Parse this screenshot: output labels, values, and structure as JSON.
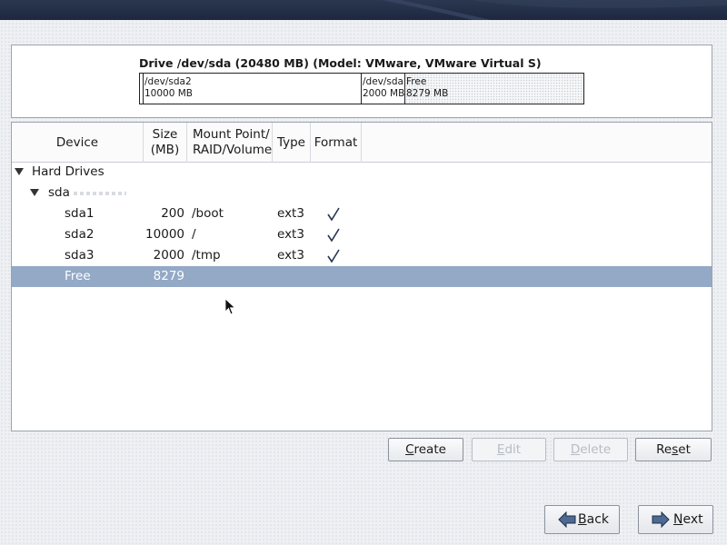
{
  "drive": {
    "title": "Drive /dev/sda (20480 MB) (Model: VMware, VMware Virtual S)",
    "segments": [
      {
        "name": "",
        "size": "",
        "kind": "sda1"
      },
      {
        "name": "/dev/sda2",
        "size": "10000 MB",
        "kind": "sda2"
      },
      {
        "name": "/dev/sda",
        "size": "2000 MB",
        "kind": "sda3"
      },
      {
        "name": "Free",
        "size": "8279 MB",
        "kind": "free"
      }
    ]
  },
  "table": {
    "headers": {
      "device": "Device",
      "size_line1": "Size",
      "size_line2": "(MB)",
      "mount_line1": "Mount Point/",
      "mount_line2": "RAID/Volume",
      "type": "Type",
      "format": "Format"
    },
    "group": "Hard Drives",
    "disk": "sda",
    "rows": [
      {
        "device": "sda1",
        "size": "200",
        "mount": "/boot",
        "type": "ext3",
        "format": true
      },
      {
        "device": "sda2",
        "size": "10000",
        "mount": "/",
        "type": "ext3",
        "format": true
      },
      {
        "device": "sda3",
        "size": "2000",
        "mount": "/tmp",
        "type": "ext3",
        "format": true
      },
      {
        "device": "Free",
        "size": "8279",
        "mount": "",
        "type": "",
        "format": false,
        "selected": true
      }
    ]
  },
  "actions": {
    "create_mnemonic": "C",
    "create_rest": "reate",
    "edit_mnemonic": "E",
    "edit_rest": "dit",
    "delete_mnemonic": "D",
    "delete_rest": "elete",
    "reset_prefix": "Re",
    "reset_mnemonic": "s",
    "reset_rest": "et"
  },
  "nav": {
    "back_mnemonic": "B",
    "back_rest": "ack",
    "next_mnemonic": "N",
    "next_rest": "ext"
  },
  "icons": {
    "format": "checkmark-icon",
    "expander": "triangle-down-icon",
    "back": "arrow-left-icon",
    "next": "arrow-right-icon"
  },
  "colors": {
    "selection": "#93a9c6",
    "banner": "#1d2740"
  }
}
